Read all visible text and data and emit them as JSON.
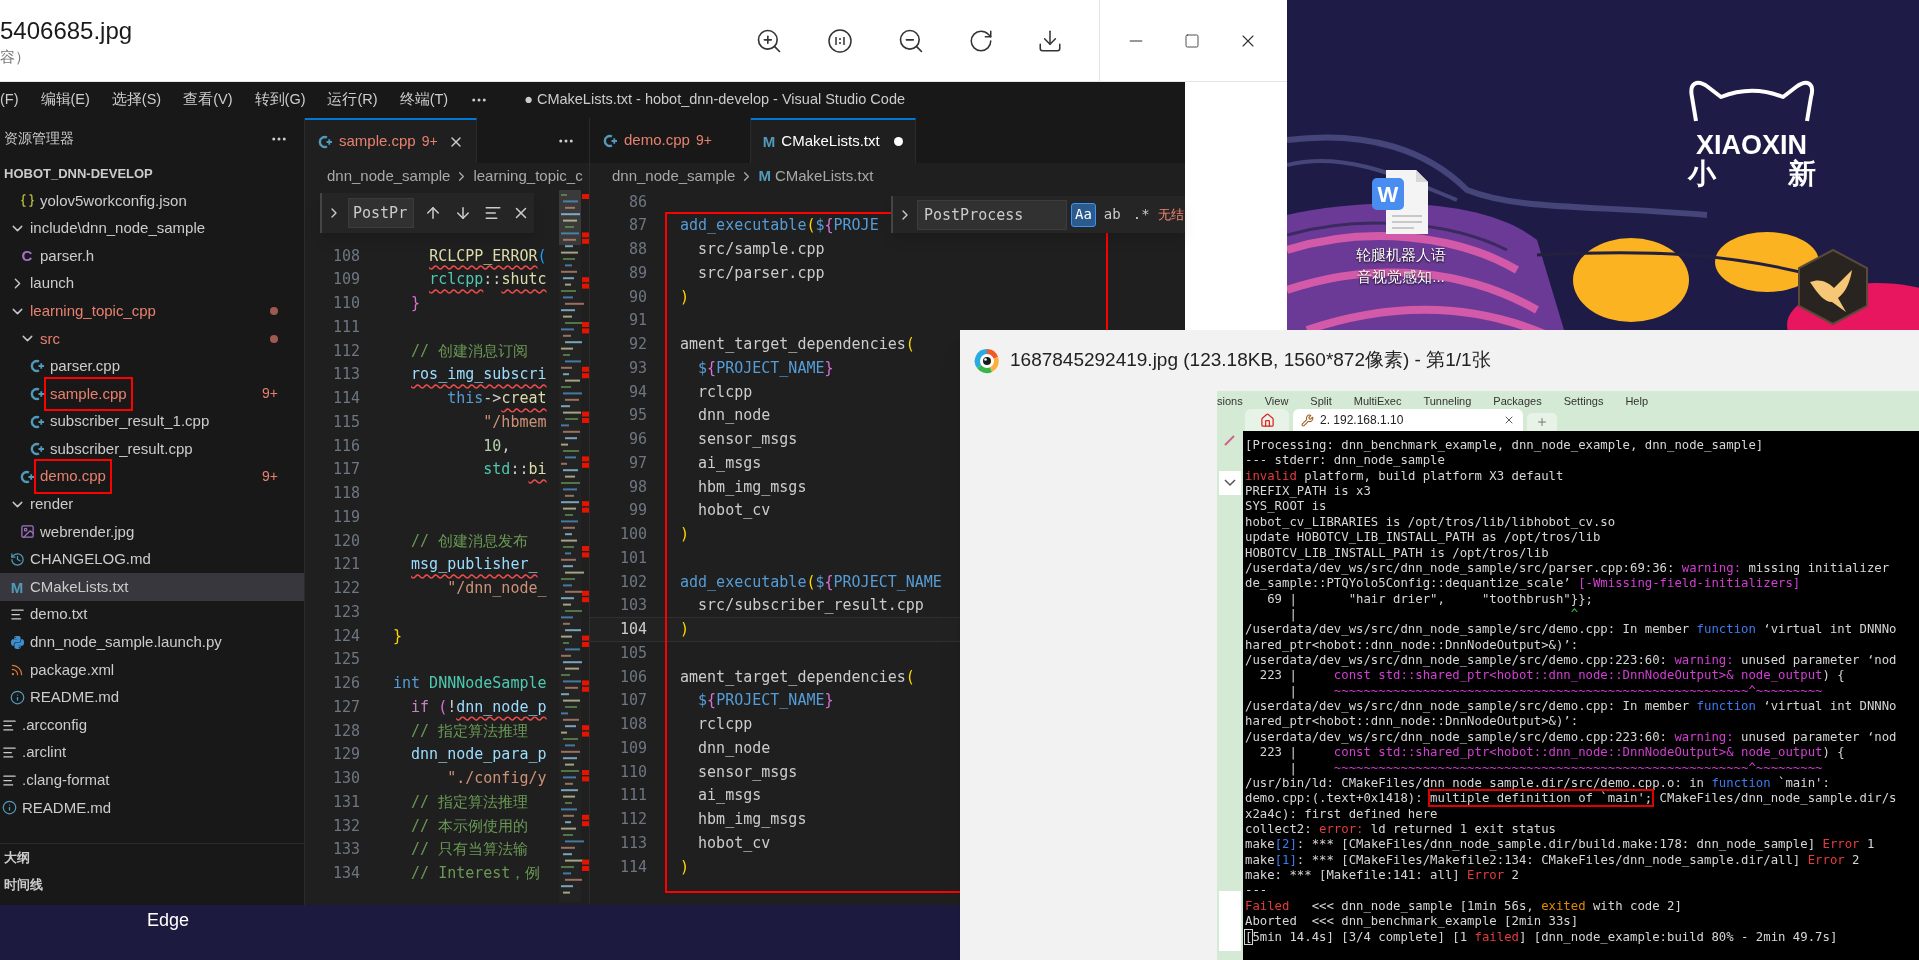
{
  "viewer": {
    "filename": "5406685.jpg",
    "subtitle": "容）"
  },
  "vscode": {
    "menu": [
      "(F)",
      "编辑(E)",
      "选择(S)",
      "查看(V)",
      "转到(G)",
      "运行(R)",
      "终端(T)"
    ],
    "title": "● CMakeLists.txt - hobot_dnn-develop - Visual Studio Code",
    "explorer": {
      "header": "资源管理器",
      "root": "HOBOT_DNN-DEVELOP",
      "tree": [
        {
          "children": [
            {
              "children": [
                {
                  "label": "yolov5workconfig.json",
                  "kind": "json",
                  "selected": false,
                  "modified": false,
                  "annotated": false
                }
              ]
            },
            {
              "label": "include\\dnn_node_sample",
              "kind": "folder",
              "expanded": true,
              "selected": false,
              "modified": false,
              "annotated": false,
              "children": [
                {
                  "label": "parser.h",
                  "kind": "c-header",
                  "glyph": "C",
                  "selected": false,
                  "modified": false,
                  "annotated": false
                }
              ]
            },
            {
              "label": "launch",
              "kind": "folder",
              "expanded": false,
              "selected": false,
              "modified": false,
              "annotated": false
            },
            {
              "label": "learning_topic_cpp",
              "kind": "folder",
              "expanded": true,
              "selected": false,
              "modified": true,
              "annotated": false,
              "children": [
                {
                  "label": "src",
                  "kind": "folder",
                  "expanded": true,
                  "selected": false,
                  "modified": true,
                  "annotated": false,
                  "children": [
                    {
                      "label": "parser.cpp",
                      "kind": "cpp",
                      "selected": false,
                      "modified": false,
                      "annotated": false
                    },
                    {
                      "label": "sample.cpp",
                      "kind": "cpp",
                      "badge": "9+",
                      "selected": false,
                      "modified": true,
                      "annotated": true
                    },
                    {
                      "label": "subscriber_result_1.cpp",
                      "kind": "cpp",
                      "selected": false,
                      "modified": false,
                      "annotated": false
                    },
                    {
                      "label": "subscriber_result.cpp",
                      "kind": "cpp",
                      "selected": false,
                      "modified": false,
                      "annotated": false
                    }
                  ]
                },
                {
                  "label": "demo.cpp",
                  "kind": "cpp",
                  "badge": "9+",
                  "selected": false,
                  "modified": true,
                  "annotated": true
                }
              ]
            },
            {
              "label": "render",
              "kind": "folder",
              "expanded": true,
              "selected": false,
              "modified": false,
              "annotated": false,
              "children": [
                {
                  "label": "webrender.jpg",
                  "kind": "image",
                  "selected": false,
                  "modified": false,
                  "annotated": false
                }
              ]
            },
            {
              "label": "CHANGELOG.md",
              "kind": "history",
              "selected": false,
              "modified": false,
              "annotated": false
            },
            {
              "label": "CMakeLists.txt",
              "kind": "cmake",
              "glyph": "M",
              "selected": true,
              "modified": false,
              "annotated": false
            },
            {
              "label": "demo.txt",
              "kind": "text",
              "selected": false,
              "modified": false,
              "annotated": false
            },
            {
              "label": "dnn_node_sample.launch.py",
              "kind": "python",
              "selected": false,
              "modified": false,
              "annotated": false
            },
            {
              "label": "package.xml",
              "kind": "rss",
              "selected": false,
              "modified": false,
              "annotated": false
            },
            {
              "label": "README.md",
              "kind": "info",
              "selected": false,
              "modified": false,
              "annotated": false
            }
          ]
        },
        {
          "label": ".arcconfig",
          "kind": "text",
          "selected": false,
          "modified": false,
          "annotated": false
        },
        {
          "label": ".arclint",
          "kind": "text",
          "selected": false,
          "modified": false,
          "annotated": false
        },
        {
          "label": ".clang-format",
          "kind": "text",
          "selected": false,
          "modified": false,
          "annotated": false
        },
        {
          "label": "README.md",
          "kind": "info",
          "selected": false,
          "modified": false,
          "annotated": false
        }
      ],
      "sections": [
        "大纲",
        "时间线"
      ]
    },
    "editors": [
      {
        "tabs": [
          {
            "label": "sample.cpp",
            "kind": "cpp",
            "badge": "9+",
            "modified": true,
            "selected": true,
            "dirty": false
          }
        ],
        "breadcrumb": [
          {
            "label": "dnn_node_sample",
            "kind": "folder"
          },
          {
            "label": "learning_topic_c",
            "kind": "folder"
          }
        ],
        "find": {
          "kind": "narrow",
          "value": "PostPr"
        },
        "annotated": false,
        "lines": [
          {
            "n": "108",
            "tokens": [
              {
                "t": "    RCLCPP_ERROR",
                "kind": "fn",
                "err": true
              },
              {
                "t": "(",
                "kind": "p3"
              }
            ]
          },
          {
            "n": "109",
            "tokens": [
              {
                "t": "    rclcpp",
                "kind": "type",
                "err": true
              },
              {
                "t": "::",
                "kind": "plain"
              },
              {
                "t": "shutc",
                "kind": "fn",
                "err": true
              }
            ]
          },
          {
            "n": "110",
            "tokens": [
              {
                "t": "  }",
                "kind": "p2"
              }
            ]
          },
          {
            "n": "111"
          },
          {
            "n": "112",
            "tokens": [
              {
                "t": "  // 创建消息订阅",
                "kind": "cmt"
              }
            ]
          },
          {
            "n": "113",
            "tokens": [
              {
                "t": "  ros_img_subscri",
                "kind": "var",
                "err": true
              }
            ]
          },
          {
            "n": "114",
            "tokens": [
              {
                "t": "      this",
                "kind": "kw"
              },
              {
                "t": "->",
                "kind": "plain"
              },
              {
                "t": "creat",
                "kind": "fn",
                "err": true
              }
            ]
          },
          {
            "n": "115",
            "tokens": [
              {
                "t": "          \"/hbmem",
                "kind": "str"
              }
            ]
          },
          {
            "n": "116",
            "tokens": [
              {
                "t": "          10",
                "kind": "num"
              },
              {
                "t": ",",
                "kind": "plain"
              }
            ]
          },
          {
            "n": "117",
            "tokens": [
              {
                "t": "          std",
                "kind": "type"
              },
              {
                "t": "::",
                "kind": "plain"
              },
              {
                "t": "bi",
                "kind": "fn",
                "err": true
              }
            ]
          },
          {
            "n": "118"
          },
          {
            "n": "119"
          },
          {
            "n": "120",
            "tokens": [
              {
                "t": "  // 创建消息发布",
                "kind": "cmt"
              }
            ]
          },
          {
            "n": "121",
            "tokens": [
              {
                "t": "  msg_publisher_",
                "kind": "var",
                "err": true
              }
            ]
          },
          {
            "n": "122",
            "tokens": [
              {
                "t": "      \"/dnn_node_",
                "kind": "str"
              }
            ]
          },
          {
            "n": "123"
          },
          {
            "n": "124",
            "tokens": [
              {
                "t": "}",
                "kind": "p1"
              }
            ]
          },
          {
            "n": "125"
          },
          {
            "n": "126",
            "tokens": [
              {
                "t": "int",
                "kind": "kw"
              },
              {
                "t": " DNNNodeSample",
                "kind": "type"
              }
            ]
          },
          {
            "n": "127",
            "tokens": [
              {
                "t": "  if",
                "kind": "ctrl"
              },
              {
                "t": " (",
                "kind": "p2"
              },
              {
                "t": "!",
                "kind": "plain"
              },
              {
                "t": "dnn_node_p",
                "kind": "var",
                "err": true
              }
            ]
          },
          {
            "n": "128",
            "tokens": [
              {
                "t": "  // 指定算法推理",
                "kind": "cmt"
              }
            ]
          },
          {
            "n": "129",
            "tokens": [
              {
                "t": "  dnn_node_para_p",
                "kind": "var"
              }
            ]
          },
          {
            "n": "130",
            "tokens": [
              {
                "t": "      \"./config/y",
                "kind": "str"
              }
            ]
          },
          {
            "n": "131",
            "tokens": [
              {
                "t": "  // 指定算法推理",
                "kind": "cmt"
              }
            ]
          },
          {
            "n": "132",
            "tokens": [
              {
                "t": "  // 本示例使用的",
                "kind": "cmt"
              }
            ]
          },
          {
            "n": "133",
            "tokens": [
              {
                "t": "  // 只有当算法输",
                "kind": "cmt"
              }
            ]
          },
          {
            "n": "134",
            "tokens": [
              {
                "t": "  // Interest，例",
                "kind": "cmt"
              }
            ]
          }
        ]
      },
      {
        "tabs": [
          {
            "label": "demo.cpp",
            "kind": "cpp",
            "badge": "9+",
            "modified": true,
            "selected": false,
            "dirty": false
          },
          {
            "label": "CMakeLists.txt",
            "kind": "cmake",
            "glyph": "M",
            "modified": false,
            "selected": true,
            "dirty": true
          }
        ],
        "breadcrumb": [
          {
            "label": "dnn_node_sample",
            "kind": "folder"
          },
          {
            "label": "CMakeLists.txt",
            "kind": "cmake",
            "glyph": "M"
          }
        ],
        "find": {
          "kind": "wide",
          "value": "PostProcess",
          "toggles": [
            {
              "label": "Aa",
              "on": true
            },
            {
              "label": "ab",
              "on": false
            },
            {
              "label": ".*",
              "on": false
            }
          ],
          "status": "无结"
        },
        "annotated": true,
        "lines": [
          {
            "n": "86",
            "current": false
          },
          {
            "n": "87",
            "current": false,
            "tokens": [
              {
                "t": "add_executable",
                "kind": "kw"
              },
              {
                "t": "(",
                "kind": "p1"
              },
              {
                "t": "$",
                "kind": "kw"
              },
              {
                "t": "{",
                "kind": "p2"
              },
              {
                "t": "PROJE",
                "kind": "kw"
              }
            ]
          },
          {
            "n": "88",
            "current": false,
            "tokens": [
              {
                "t": "  src/sample.cpp",
                "kind": "plain"
              }
            ]
          },
          {
            "n": "89",
            "current": false,
            "tokens": [
              {
                "t": "  src/parser.cpp",
                "kind": "plain"
              }
            ]
          },
          {
            "n": "90",
            "current": false,
            "tokens": [
              {
                "t": ")",
                "kind": "p1"
              }
            ]
          },
          {
            "n": "91",
            "current": false
          },
          {
            "n": "92",
            "current": false,
            "tokens": [
              {
                "t": "ament_target_dependencies",
                "kind": "plain"
              },
              {
                "t": "(",
                "kind": "p1"
              }
            ]
          },
          {
            "n": "93",
            "current": false,
            "tokens": [
              {
                "t": "  $",
                "kind": "kw"
              },
              {
                "t": "{",
                "kind": "p2"
              },
              {
                "t": "PROJECT_NAME",
                "kind": "kw"
              },
              {
                "t": "}",
                "kind": "p2"
              }
            ]
          },
          {
            "n": "94",
            "current": false,
            "tokens": [
              {
                "t": "  rclcpp",
                "kind": "plain"
              }
            ]
          },
          {
            "n": "95",
            "current": false,
            "tokens": [
              {
                "t": "  dnn_node",
                "kind": "plain"
              }
            ]
          },
          {
            "n": "96",
            "current": false,
            "tokens": [
              {
                "t": "  sensor_msgs",
                "kind": "plain"
              }
            ]
          },
          {
            "n": "97",
            "current": false,
            "tokens": [
              {
                "t": "  ai_msgs",
                "kind": "plain"
              }
            ]
          },
          {
            "n": "98",
            "current": false,
            "tokens": [
              {
                "t": "  hbm_img_msgs",
                "kind": "plain"
              }
            ]
          },
          {
            "n": "99",
            "current": false,
            "tokens": [
              {
                "t": "  hobot_cv",
                "kind": "plain"
              }
            ]
          },
          {
            "n": "100",
            "current": false,
            "tokens": [
              {
                "t": ")",
                "kind": "p1"
              }
            ]
          },
          {
            "n": "101",
            "current": false
          },
          {
            "n": "102",
            "current": false,
            "tokens": [
              {
                "t": "add_executable",
                "kind": "kw"
              },
              {
                "t": "(",
                "kind": "p1"
              },
              {
                "t": "$",
                "kind": "kw"
              },
              {
                "t": "{",
                "kind": "p2"
              },
              {
                "t": "PROJECT_NAME",
                "kind": "kw"
              }
            ]
          },
          {
            "n": "103",
            "current": false,
            "tokens": [
              {
                "t": "  src/subscriber_result.cpp",
                "kind": "plain"
              }
            ]
          },
          {
            "n": "104",
            "current": true,
            "tokens": [
              {
                "t": ")",
                "kind": "p1"
              }
            ]
          },
          {
            "n": "105",
            "current": false
          },
          {
            "n": "106",
            "current": false,
            "tokens": [
              {
                "t": "ament_target_dependencies",
                "kind": "plain"
              },
              {
                "t": "(",
                "kind": "p1"
              }
            ]
          },
          {
            "n": "107",
            "current": false,
            "tokens": [
              {
                "t": "  $",
                "kind": "kw"
              },
              {
                "t": "{",
                "kind": "p2"
              },
              {
                "t": "PROJECT_NAME",
                "kind": "kw"
              },
              {
                "t": "}",
                "kind": "p2"
              }
            ]
          },
          {
            "n": "108",
            "current": false,
            "tokens": [
              {
                "t": "  rclcpp",
                "kind": "plain"
              }
            ]
          },
          {
            "n": "109",
            "current": false,
            "tokens": [
              {
                "t": "  dnn_node",
                "kind": "plain"
              }
            ]
          },
          {
            "n": "110",
            "current": false,
            "tokens": [
              {
                "t": "  sensor_msgs",
                "kind": "plain"
              }
            ]
          },
          {
            "n": "111",
            "current": false,
            "tokens": [
              {
                "t": "  ai_msgs",
                "kind": "plain"
              }
            ]
          },
          {
            "n": "112",
            "current": false,
            "tokens": [
              {
                "t": "  hbm_img_msgs",
                "kind": "plain"
              }
            ]
          },
          {
            "n": "113",
            "current": false,
            "tokens": [
              {
                "t": "  hobot_cv",
                "kind": "plain"
              }
            ]
          },
          {
            "n": "114",
            "current": false,
            "tokens": [
              {
                "t": ")",
                "kind": "p1"
              }
            ]
          }
        ]
      }
    ]
  },
  "bottom_strip": {
    "label": "Edge"
  },
  "desktop": {
    "logo": {
      "wordmark": "XIAOXIN",
      "chars": [
        "小",
        "新"
      ]
    },
    "file": {
      "glyph": "W",
      "label": "轮腿机器人语音视觉感知..."
    }
  },
  "viewer2": {
    "title": "1687845292419.jpg (123.18KB, 1560*872像素) - 第1/1张",
    "menu": [
      "sions",
      "View",
      "Split",
      "MultiExec",
      "Tunneling",
      "Packages",
      "Settings",
      "Help"
    ],
    "tabs": [
      {
        "label": "2. 192.168.1.10",
        "selected": true
      }
    ],
    "terminal": [
      [
        {
          "t": "[Processing: dnn_benchmark_example, dnn_node_example, dnn_node_sample]",
          "kind": "n"
        }
      ],
      [
        {
          "t": "--- stderr: dnn_node_sample",
          "kind": "n"
        }
      ],
      [
        {
          "t": "invalid",
          "kind": "r"
        },
        {
          "t": " platform, build platform X3 default",
          "kind": "n"
        }
      ],
      [
        {
          "t": "PREFIX_PATH is x3",
          "kind": "n"
        }
      ],
      [
        {
          "t": "SYS_ROOT is",
          "kind": "n"
        }
      ],
      [
        {
          "t": "hobot_cv_LIBRARIES is /opt/tros/lib/libhobot_cv.so",
          "kind": "n"
        }
      ],
      [
        {
          "t": "update HOBOTCV_LIB_INSTALL_PATH as /opt/tros/lib",
          "kind": "n"
        }
      ],
      [
        {
          "t": "HOBOTCV_LIB_INSTALL_PATH is /opt/tros/lib",
          "kind": "n"
        }
      ],
      [
        {
          "t": "/userdata/dev_ws/src/dnn_node_sample/src/parser.cpp:69:36: ",
          "kind": "n"
        },
        {
          "t": "warning:",
          "kind": "w"
        },
        {
          "t": " missing initializer",
          "kind": "n"
        }
      ],
      [
        {
          "t": "de_sample::PTQYolo5Config::dequantize_scale’ ",
          "kind": "n"
        },
        {
          "t": "[-Wmissing-field-initializers]",
          "kind": "w"
        }
      ],
      [
        {
          "t": "   69 |       \"hair drier\",     \"toothbrush\"}};",
          "kind": "n"
        }
      ],
      [
        {
          "t": "      |                                     ",
          "kind": "n"
        },
        {
          "t": "^",
          "kind": "g"
        }
      ],
      [
        {
          "t": "/userdata/dev_ws/src/dnn_node_sample/src/demo.cpp: In member ",
          "kind": "n"
        },
        {
          "t": "function",
          "kind": "b"
        },
        {
          "t": " ‘virtual int DNNNo",
          "kind": "n"
        }
      ],
      [
        {
          "t": "hared_ptr<hobot::dnn_node::DnnNodeOutput>&)’:",
          "kind": "n"
        }
      ],
      [
        {
          "t": "/userdata/dev_ws/src/dnn_node_sample/src/demo.cpp:223:60: ",
          "kind": "n"
        },
        {
          "t": "warning:",
          "kind": "w"
        },
        {
          "t": " unused parameter ‘nod",
          "kind": "n"
        }
      ],
      [
        {
          "t": "  223 |     ",
          "kind": "n"
        },
        {
          "t": "const std::shared_ptr<hobot::dnn_node::DnnNodeOutput>& node_output",
          "kind": "w"
        },
        {
          "t": ") {",
          "kind": "n"
        }
      ],
      [
        {
          "t": "      |     ",
          "kind": "n"
        },
        {
          "t": "~~~~~~~~~~~~~~~~~~~~~~~~~~~~~~~~~~~~~~~~~~~~~~~~~~~~~~~~^~~~~~~~~~",
          "kind": "w"
        }
      ],
      [
        {
          "t": "/userdata/dev_ws/src/dnn_node_sample/src/demo.cpp: In member ",
          "kind": "n"
        },
        {
          "t": "function",
          "kind": "b"
        },
        {
          "t": " ‘virtual int DNNNo",
          "kind": "n"
        }
      ],
      [
        {
          "t": "hared_ptr<hobot::dnn_node::DnnNodeOutput>&)’:",
          "kind": "n"
        }
      ],
      [
        {
          "t": "/userdata/dev_ws/src/dnn_node_sample/src/demo.cpp:223:60: ",
          "kind": "n"
        },
        {
          "t": "warning:",
          "kind": "w"
        },
        {
          "t": " unused parameter ‘nod",
          "kind": "n"
        }
      ],
      [
        {
          "t": "  223 |     ",
          "kind": "n"
        },
        {
          "t": "const std::shared_ptr<hobot::dnn_node::DnnNodeOutput>& node_output",
          "kind": "w"
        },
        {
          "t": ") {",
          "kind": "n"
        }
      ],
      [
        {
          "t": "      |     ",
          "kind": "n"
        },
        {
          "t": "~~~~~~~~~~~~~~~~~~~~~~~~~~~~~~~~~~~~~~~~~~~~~~~~~~~~~~~~^~~~~~~~~~",
          "kind": "w"
        }
      ],
      [
        {
          "t": "/usr/bin/ld: CMakeFiles/dnn_node_sample.dir/src/demo.cpp.o: in ",
          "kind": "n"
        },
        {
          "t": "function",
          "kind": "b"
        },
        {
          "t": " `main':",
          "kind": "n"
        }
      ],
      [
        {
          "t": "demo.cpp:(.text+0x1418): ",
          "kind": "n"
        },
        {
          "t": "multiple definition of `main';",
          "kind": "box"
        },
        {
          "t": " CMakeFiles/dnn_node_sample.dir/s",
          "kind": "n"
        }
      ],
      [
        {
          "t": "x2a4c): first defined here",
          "kind": "n"
        }
      ],
      [
        {
          "t": "collect2: ",
          "kind": "n"
        },
        {
          "t": "error:",
          "kind": "r"
        },
        {
          "t": " ld returned 1 exit status",
          "kind": "n"
        }
      ],
      [
        {
          "t": "make",
          "kind": "n"
        },
        {
          "t": "[2]",
          "kind": "b"
        },
        {
          "t": ": *** [CMakeFiles/dnn_node_sample.dir/build.make:178: dnn_node_sample] ",
          "kind": "n"
        },
        {
          "t": "Error",
          "kind": "r"
        },
        {
          "t": " 1",
          "kind": "n"
        }
      ],
      [
        {
          "t": "make",
          "kind": "n"
        },
        {
          "t": "[1]",
          "kind": "b"
        },
        {
          "t": ": *** [CMakeFiles/Makefile2:134: CMakeFiles/dnn_node_sample.dir/all] ",
          "kind": "n"
        },
        {
          "t": "Error",
          "kind": "r"
        },
        {
          "t": " 2",
          "kind": "n"
        }
      ],
      [
        {
          "t": "make: *** [Makefile:141: all] ",
          "kind": "n"
        },
        {
          "t": "Error",
          "kind": "r"
        },
        {
          "t": " 2",
          "kind": "n"
        }
      ],
      [
        {
          "t": "---",
          "kind": "n"
        }
      ],
      [
        {
          "t": "Failed",
          "kind": "r"
        },
        {
          "t": "   <<< dnn_node_sample [1min 56s, ",
          "kind": "n"
        },
        {
          "t": "exited",
          "kind": "o"
        },
        {
          "t": " with code 2]",
          "kind": "n"
        }
      ],
      [
        {
          "t": "Aborted  <<< dnn_benchmark_example [2min 33s]",
          "kind": "n"
        }
      ],
      [
        {
          "t": "[",
          "kind": "cur"
        },
        {
          "t": "5min 14.4s] [3/4 complete] [1 ",
          "kind": "n"
        },
        {
          "t": "failed",
          "kind": "r"
        },
        {
          "t": "] [dnn_node_example:build 80% - 2min 49.7s]",
          "kind": "n"
        }
      ]
    ]
  }
}
